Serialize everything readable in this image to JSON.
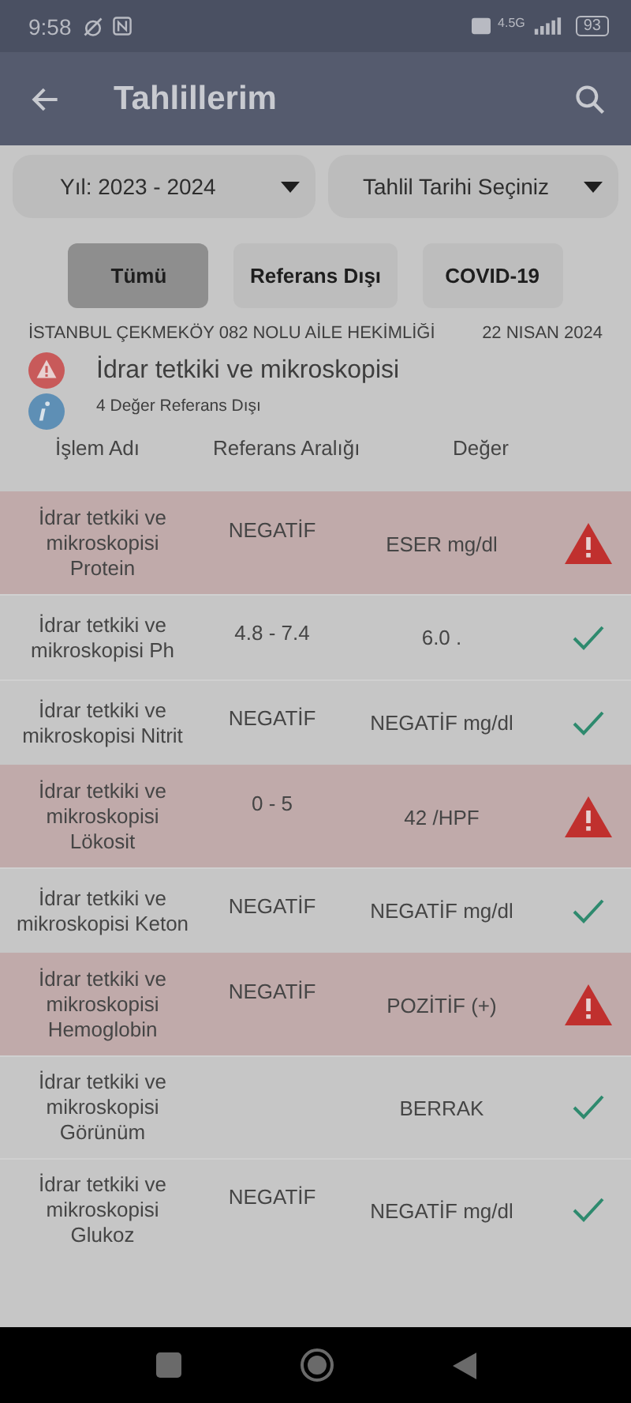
{
  "status_bar": {
    "time": "9:58",
    "network": "4.5G",
    "battery": "93"
  },
  "app_bar": {
    "title": "Tahlillerim"
  },
  "filters": [
    {
      "label": "Yıl: 2023 - 2024"
    },
    {
      "label": "Tahlil Tarihi Seçiniz"
    }
  ],
  "tabs": [
    {
      "label": "Tümü",
      "selected": true
    },
    {
      "label": "Referans Dışı",
      "selected": false
    },
    {
      "label": "COVID-19",
      "selected": false
    }
  ],
  "test": {
    "institution": "İSTANBUL ÇEKMEKÖY 082 NOLU AİLE HEKİMLİĞİ",
    "date": "22 NISAN 2024",
    "name": "İdrar tetkiki ve mikroskopisi",
    "summary": "4 Değer Referans Dışı"
  },
  "table": {
    "columns": [
      "İşlem Adı",
      "Referans Aralığı",
      "Değer"
    ],
    "rows": [
      {
        "name": "İdrar tetkiki ve mikroskopisi Protein",
        "range": "NEGATİF",
        "value": "ESER mg/dl",
        "out_of_range": true
      },
      {
        "name": "İdrar tetkiki ve mikroskopisi Ph",
        "range": "4.8 - 7.4",
        "value": "6.0 .",
        "out_of_range": false
      },
      {
        "name": "İdrar tetkiki ve mikroskopisi Nitrit",
        "range": "NEGATİF",
        "value": "NEGATİF mg/dl",
        "out_of_range": false
      },
      {
        "name": "İdrar tetkiki ve mikroskopisi Lökosit",
        "range": "0 - 5",
        "value": "42 /HPF",
        "out_of_range": true
      },
      {
        "name": "İdrar tetkiki ve mikroskopisi Keton",
        "range": "NEGATİF",
        "value": "NEGATİF mg/dl",
        "out_of_range": false
      },
      {
        "name": "İdrar tetkiki ve mikroskopisi Hemoglobin",
        "range": "NEGATİF",
        "value": "POZİTİF (+)",
        "out_of_range": true
      },
      {
        "name": "İdrar tetkiki ve mikroskopisi Görünüm",
        "value": "BERRAK",
        "out_of_range": false
      },
      {
        "name": "İdrar tetkiki ve mikroskopisi Glukoz",
        "range": "NEGATİF",
        "value": "NEGATİF mg/dl",
        "out_of_range": false
      }
    ]
  }
}
